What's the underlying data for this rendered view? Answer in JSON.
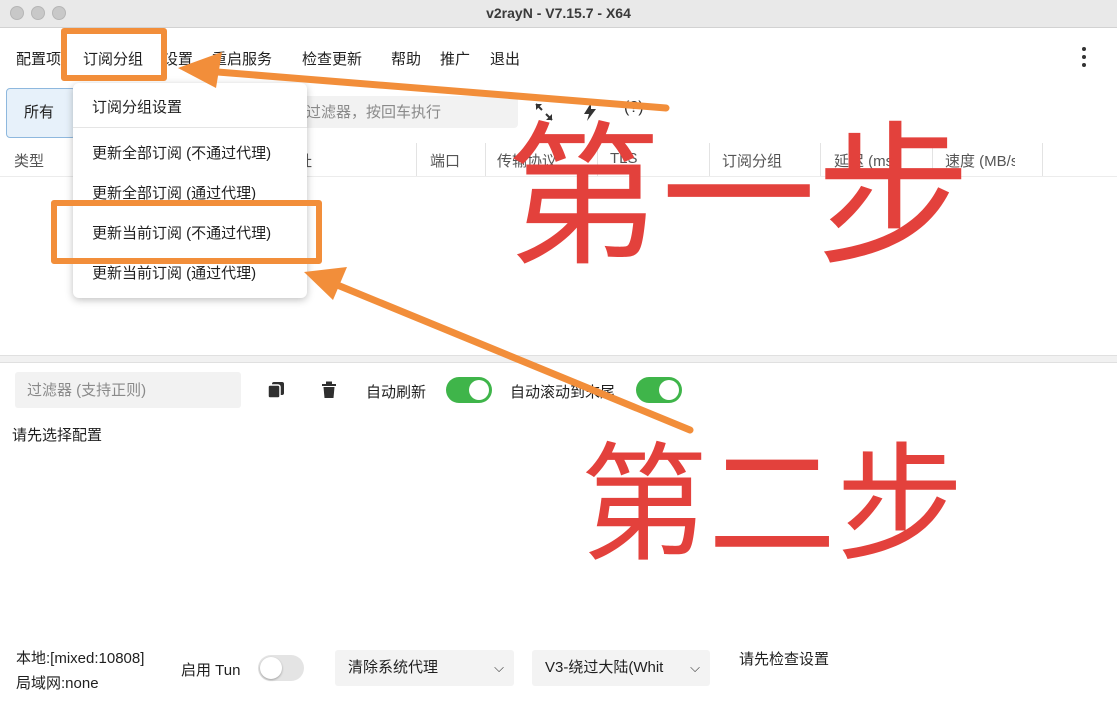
{
  "window": {
    "title": "v2rayN - V7.15.7 - X64"
  },
  "menubar": {
    "items": [
      "配置项",
      "订阅分组",
      "设置",
      "重启服务",
      "检查更新",
      "帮助",
      "推广",
      "退出"
    ]
  },
  "toolbar": {
    "group_tab": "所有",
    "filter_placeholder": "过滤器，按回车执行",
    "help_label": "(?)"
  },
  "table": {
    "columns": [
      "类型",
      "地址",
      "端口",
      "传输协议",
      "TLS",
      "订阅分组",
      "延迟 (ms)",
      "速度 (MB/s)"
    ]
  },
  "dropdown": {
    "items": [
      "订阅分组设置",
      "更新全部订阅 (不通过代理)",
      "更新全部订阅 (通过代理)",
      "更新当前订阅 (不通过代理)",
      "更新当前订阅 (通过代理)"
    ]
  },
  "log": {
    "filter_placeholder": "过滤器 (支持正则)",
    "auto_refresh_label": "自动刷新",
    "auto_refresh": true,
    "auto_scroll_label": "自动滚动到末尾",
    "auto_scroll": true,
    "message": "请先选择配置"
  },
  "statusbar": {
    "local": "本地:[mixed:10808]",
    "lan": "局域网:none",
    "tun_label": "启用 Tun",
    "tun_enabled": false,
    "proxy_mode": "清除系统代理",
    "routing": "V3-绕过大陆(Whit",
    "message": "请先检查设置"
  },
  "annotations": {
    "step1": "第一步",
    "step2": "第二步",
    "color_box": "#f28e3a",
    "color_text": "#e3413c"
  }
}
